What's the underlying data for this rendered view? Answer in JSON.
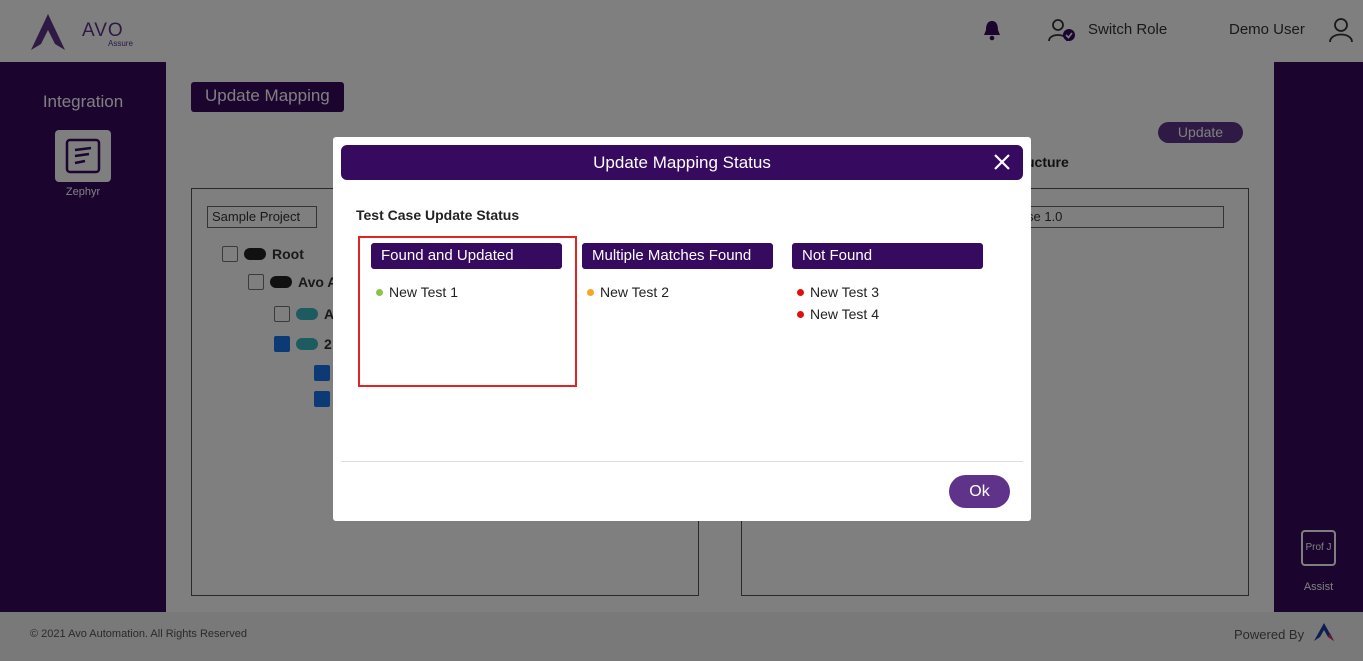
{
  "app": {
    "logo_text": "AVO",
    "logo_sub": "Assure",
    "switch_role_label": "Switch Role",
    "user_name": "Demo User"
  },
  "sidebar": {
    "title": "Integration",
    "items": [
      {
        "label": "Zephyr",
        "icon": "zephyr-icon"
      }
    ]
  },
  "right_rail": {
    "items": [
      {
        "label": "Assist",
        "tile_text": "Prof J"
      }
    ]
  },
  "main": {
    "page_title": "Update Mapping",
    "update_button": "Update",
    "structure_label": "ucture",
    "left_panel": {
      "project_select": "Sample Project",
      "tree": [
        {
          "label": "Root",
          "checked": false
        },
        {
          "label": "Avo A",
          "checked": false
        },
        {
          "label": "A",
          "checked": false
        },
        {
          "label": "2",
          "checked": true
        },
        {
          "label": "",
          "checked": true
        },
        {
          "label": "",
          "checked": true
        }
      ]
    },
    "right_panel": {
      "release_select": "se 1.0"
    }
  },
  "footer": {
    "copyright": "© 2021 Avo Automation. All Rights Reserved",
    "powered_by": "Powered By"
  },
  "modal": {
    "title": "Update Mapping Status",
    "section_label": "Test Case Update Status",
    "columns": [
      {
        "header": "Found and Updated",
        "dot_color": "#8bc34a",
        "items": [
          "New Test 1"
        ]
      },
      {
        "header": "Multiple Matches Found",
        "dot_color": "#f5a623",
        "items": [
          "New Test 2"
        ]
      },
      {
        "header": "Not Found",
        "dot_color": "#e01010",
        "items": [
          "New Test 3",
          "New Test 4"
        ]
      }
    ],
    "ok_label": "Ok"
  },
  "colors": {
    "brand_dark": "#360a5e",
    "brand_button": "#5f338a",
    "highlight": "#e02424"
  }
}
